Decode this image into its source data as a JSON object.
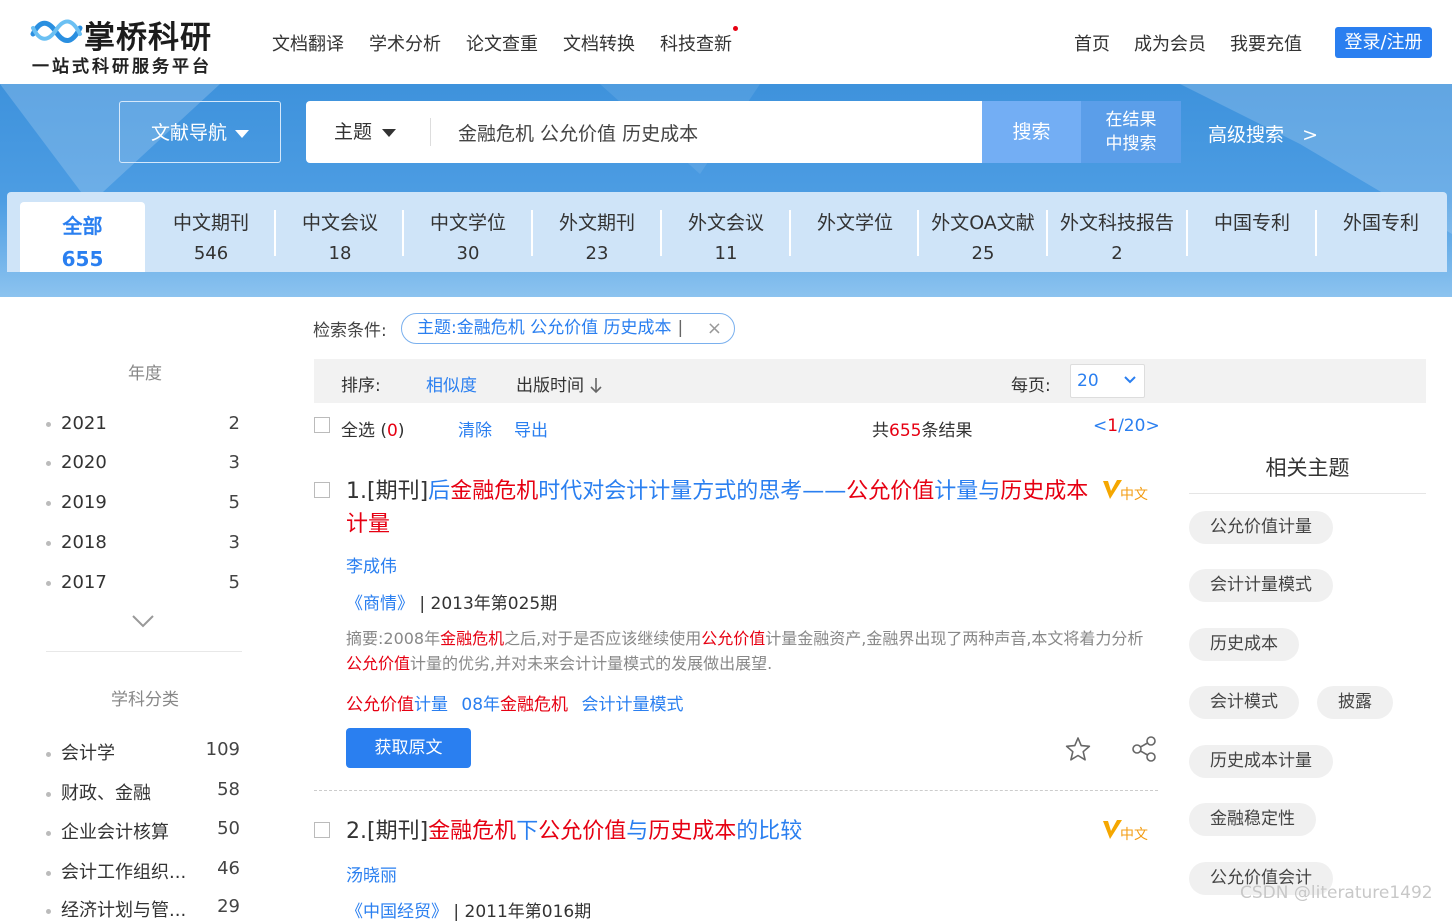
{
  "header": {
    "logo_title": "掌桥科研",
    "logo_subtitle": "一站式科研服务平台",
    "nav": [
      "文档翻译",
      "学术分析",
      "论文查重",
      "文档转换",
      "科技查新"
    ],
    "nav_right": [
      "首页",
      "成为会员",
      "我要充值"
    ],
    "login_label": "登录/注册"
  },
  "search": {
    "nav_button": "文献导航",
    "type": "主题",
    "query": "金融危机 公允价值 历史成本",
    "search_label": "搜索",
    "in_result_label_1": "在结果",
    "in_result_label_2": "中搜索",
    "advanced_label": "高级搜索",
    "advanced_arrow": ">"
  },
  "tabs": [
    {
      "name": "全部",
      "count": "655"
    },
    {
      "name": "中文期刊",
      "count": "546"
    },
    {
      "name": "中文会议",
      "count": "18"
    },
    {
      "name": "中文学位",
      "count": "30"
    },
    {
      "name": "外文期刊",
      "count": "23"
    },
    {
      "name": "外文会议",
      "count": "11"
    },
    {
      "name": "外文学位",
      "count": ""
    },
    {
      "name": "外文OA文献",
      "count": "25"
    },
    {
      "name": "外文科技报告",
      "count": "2"
    },
    {
      "name": "中国专利",
      "count": ""
    },
    {
      "name": "外国专利",
      "count": ""
    }
  ],
  "sidebar": {
    "year_head": "年度",
    "years": [
      {
        "label": "2021",
        "count": "2"
      },
      {
        "label": "2020",
        "count": "3"
      },
      {
        "label": "2019",
        "count": "5"
      },
      {
        "label": "2018",
        "count": "3"
      },
      {
        "label": "2017",
        "count": "5"
      }
    ],
    "subject_head": "学科分类",
    "subjects": [
      {
        "label": "会计学",
        "count": "109"
      },
      {
        "label": "财政、金融",
        "count": "58"
      },
      {
        "label": "企业会计核算",
        "count": "50"
      },
      {
        "label": "会计工作组织...",
        "count": "46"
      },
      {
        "label": "经济计划与管...",
        "count": "29"
      }
    ]
  },
  "results": {
    "cond_label": "检索条件:",
    "cond_tag": "主题:金融危机 公允价值 历史成本",
    "cond_bar": "|",
    "cond_close": "×",
    "sort_label": "排序:",
    "sort_relevance": "相似度",
    "sort_date": "出版时间",
    "per_page_label": "每页:",
    "per_page_value": "20",
    "select_all": "全选",
    "select_open": "(",
    "select_count": "0",
    "select_close": ")",
    "clear": "清除",
    "export": "导出",
    "total_prefix": "共",
    "total_count": "655",
    "total_suffix": "条结果",
    "pager_prev": "<",
    "pager_current": "1",
    "pager_rest": "/20>",
    "lang_badge": "中文",
    "items": [
      {
        "index": "1.[期刊]",
        "title_parts": [
          "后",
          "金融危机",
          "时代对会计计量方式的思考——",
          "公允价值",
          "计量与",
          "历史成本",
          "计量"
        ],
        "author": "李成伟",
        "journal": "《商情》",
        "issue": "| 2013年第025期",
        "abstract_parts": [
          "摘要:2008年",
          "金融危机",
          "之后,对于是否应该继续使用",
          "公允价值",
          "计量金融资产,金融界出现了两种声音,本文将着力分析",
          "公允价值",
          "计量的优劣,并对未来会计计量模式的发展做出展望."
        ],
        "keywords": [
          {
            "parts": [
              "公允价值",
              "计量"
            ]
          },
          {
            "parts": [
              "08年",
              "金融危机"
            ]
          },
          {
            "parts": [
              "会计计量模式"
            ]
          }
        ],
        "get_label": "获取原文"
      },
      {
        "index": "2.[期刊]",
        "title_parts": [
          "",
          "金融危机",
          "下",
          "公允价值",
          "与",
          "历史成本",
          "的比较"
        ],
        "author": "汤晓丽",
        "journal": "《中国经贸》",
        "issue": "| 2011年第016期"
      }
    ]
  },
  "related": {
    "head": "相关主题",
    "chips": [
      "公允价值计量",
      "会计计量模式",
      "历史成本",
      "会计模式",
      "披露",
      "历史成本计量",
      "金融稳定性",
      "公允价值会计"
    ]
  },
  "watermark": "CSDN @literature1492",
  "colors": {
    "brand": "#2a7ff0",
    "highlight": "#e60012",
    "banner": "#4d9de3"
  }
}
